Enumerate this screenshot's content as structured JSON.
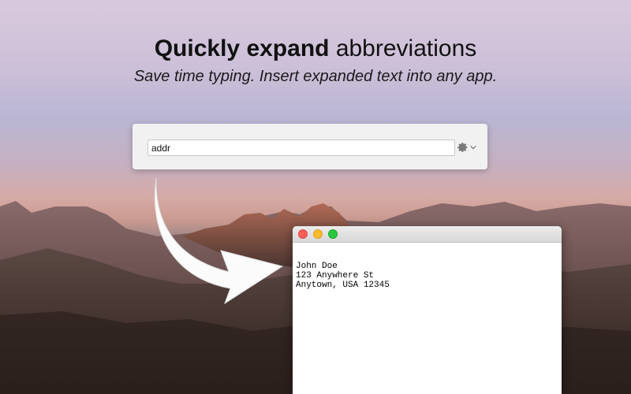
{
  "headline": {
    "bold_part": "Quickly expand",
    "rest": "abbreviations"
  },
  "subline": "Save time typing. Insert expanded text into any app.",
  "expander": {
    "input_value": "addr",
    "settings_icon": "gear-icon",
    "menu_icon": "chevron-down-icon"
  },
  "document_window": {
    "lines": [
      "John Doe",
      "123 Anywhere St",
      "Anytown, USA 12345"
    ],
    "buttons": [
      "close",
      "minimize",
      "zoom"
    ]
  },
  "colors": {
    "traffic_close": "#fc5f57",
    "traffic_minimize": "#fdbc2e",
    "traffic_zoom": "#29c840"
  }
}
